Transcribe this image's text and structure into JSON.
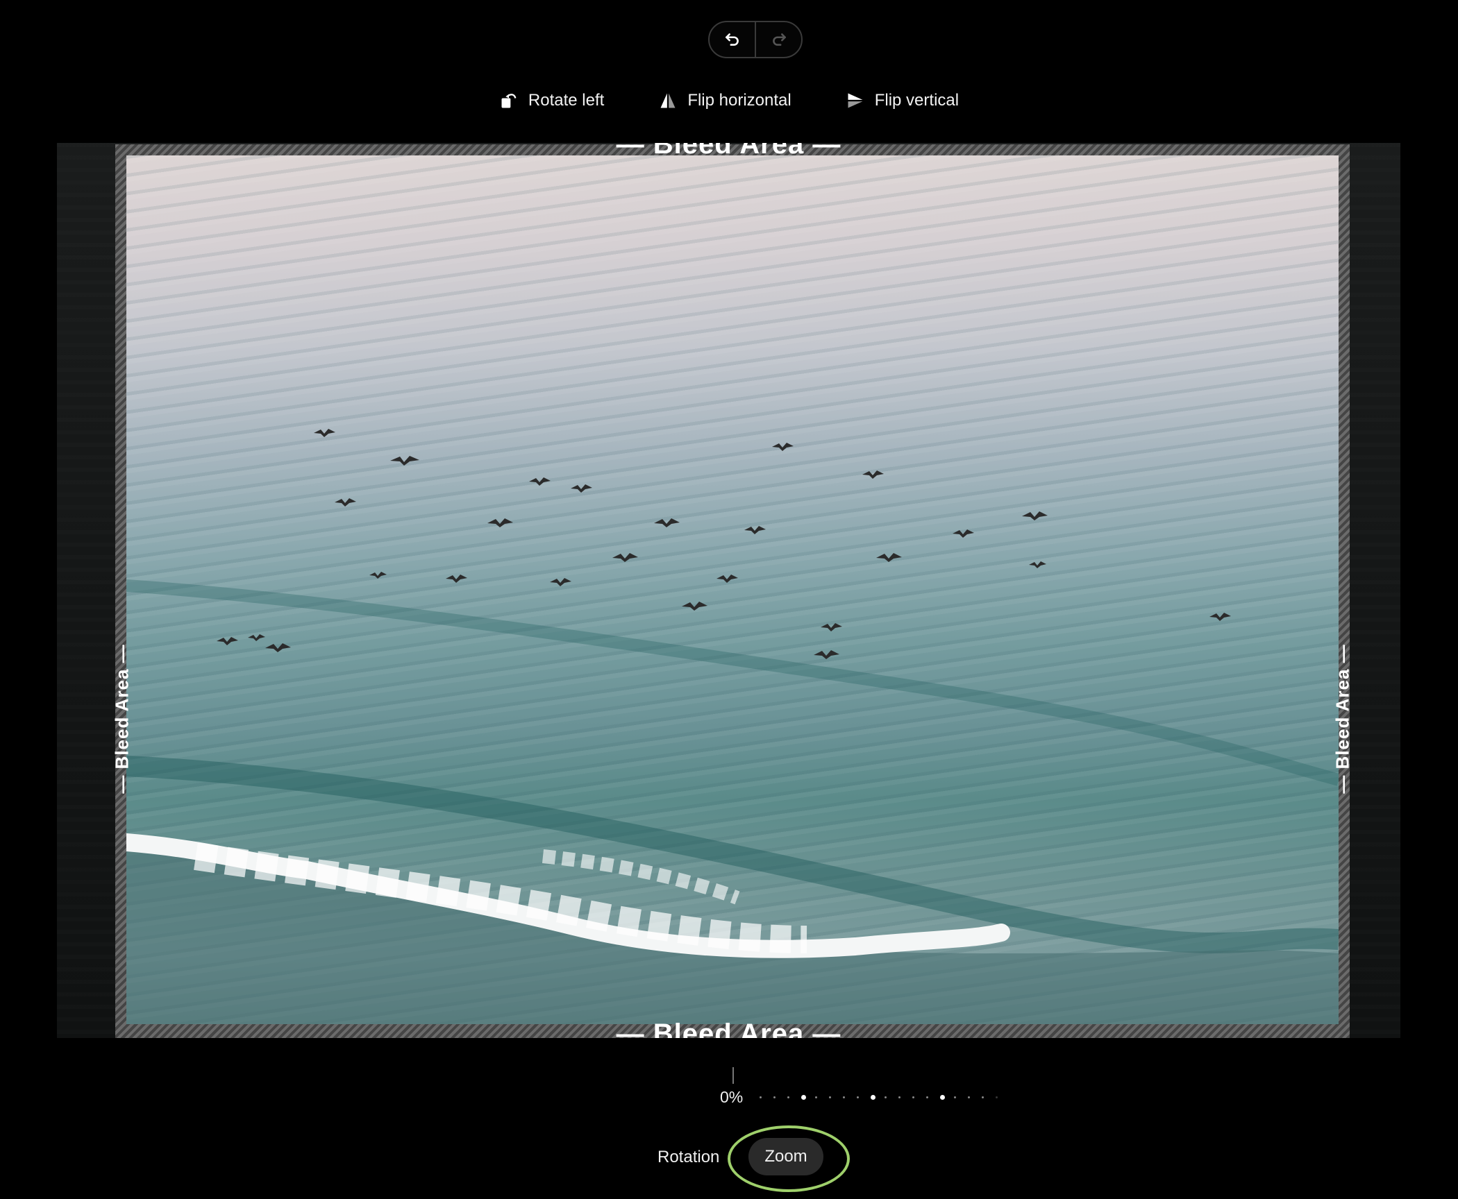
{
  "history": {
    "undo_icon": "undo-icon",
    "redo_icon": "redo-icon"
  },
  "toolbar": {
    "rotate_left_label": "Rotate left",
    "flip_horizontal_label": "Flip horizontal",
    "flip_vertical_label": "Flip vertical"
  },
  "canvas": {
    "bleed_label": "— Bleed Area —"
  },
  "zoom_slider": {
    "value": "0%"
  },
  "mode_tabs": {
    "rotation_label": "Rotation",
    "zoom_label": "Zoom",
    "selected": "Zoom"
  },
  "colors": {
    "background": "#000000",
    "focus_ring": "#9fd06b",
    "selected_tab": "#2a2a2a"
  }
}
